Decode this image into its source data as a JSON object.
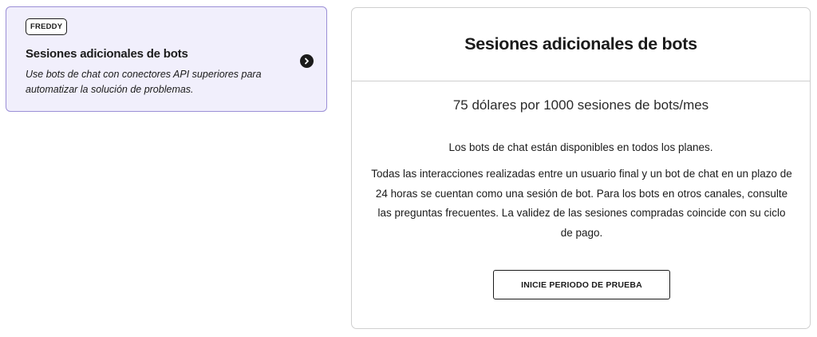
{
  "addon_card": {
    "tag": "FREDDY",
    "title": "Sesiones adicionales de bots",
    "description": "Use bots de chat con conectores API superiores para automatizar la solución de problemas.",
    "arrow_icon": "chevron-right-circle-icon"
  },
  "detail": {
    "title": "Sesiones adicionales de bots",
    "price": "75 dólares por 1000 sesiones de bots/mes",
    "availability": "Los bots de chat están disponibles en todos los planes.",
    "body": "Todas las interacciones realizadas entre un usuario final y un bot de chat en un plazo de 24 horas se cuentan como una sesión de bot. Para los bots en otros canales, consulte las preguntas frecuentes. La validez de las sesiones compradas coincide con su ciclo de pago.",
    "cta_label": "INICIE PERIODO DE PRUEBA"
  },
  "colors": {
    "addon_background": "#f1effc",
    "addon_border": "#9b8fd6",
    "text": "#1b1b1b",
    "divider": "#cfcfcf"
  }
}
